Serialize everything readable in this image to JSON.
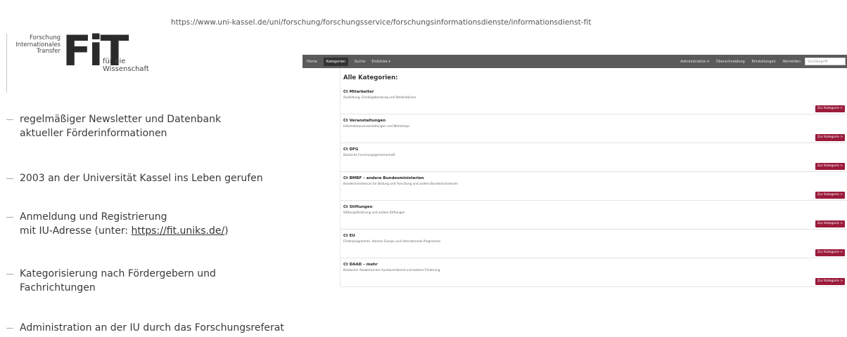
{
  "url": "https://www.uni-kassel.de/uni/forschung/forschungsservice/forschungsinformationsdienste/informationsdienst-fit",
  "logo": {
    "left_lines": [
      "Forschung",
      "Internationales",
      "Transfer"
    ],
    "mark": "FiT",
    "right_lines": [
      "für die",
      "Wissenschaft"
    ]
  },
  "bullets": [
    {
      "line1": "regelmäßiger Newsletter und Datenbank",
      "line2": "aktueller Förderinformationen"
    },
    {
      "line1": "2003 an der Universität Kassel ins Leben gerufen"
    },
    {
      "line1": "Anmeldung und Registrierung",
      "line2_prefix": "mit IU-Adresse (unter: ",
      "link": "https://fit.uniks.de/",
      "line2_suffix": ")"
    },
    {
      "line1": "Kategorisierung nach Fördergebern und",
      "line2": "Fachrichtungen"
    },
    {
      "line1": "Administration an der IU durch das Forschungsreferat"
    }
  ],
  "screenshot": {
    "nav_left": [
      "Home",
      "Kategorien",
      "Suche",
      "Einblicke ▾"
    ],
    "nav_right": [
      "Administration ▾",
      "Überschneidung",
      "Einstellungen",
      "Abmelden"
    ],
    "search_placeholder": "Suchbegriff",
    "title": "Alle Kategorien:",
    "categories": [
      {
        "name": "Ct Mitarbeiter",
        "desc": "Ausbildung, Einstiegsberatung und Stellenbörsen"
      },
      {
        "name": "Ct Veranstaltungen",
        "desc": "Informationsveranstaltungen und Workshops"
      },
      {
        "name": "Ct DFG",
        "desc": "Deutsche Forschungsgemeinschaft"
      },
      {
        "name": "Ct BMBF – andere Bundesministerien",
        "desc": "Bundesministerium für Bildung und Forschung und andere Bundesministerien"
      },
      {
        "name": "Ct Stiftungen",
        "desc": "Stiftungsförderung und andere Stiftungen"
      },
      {
        "name": "Ct EU",
        "desc": "Förderprogramme, Horizon Europe und internationale Programme"
      },
      {
        "name": "Ct DAAD – mehr",
        "desc": "Deutscher Akademischer Austauschdienst und weitere Förderung"
      }
    ],
    "button_label": "Zur Kategorie >"
  },
  "colors": {
    "navbar": "#5a5a5a",
    "button": "#9b1b3a"
  }
}
